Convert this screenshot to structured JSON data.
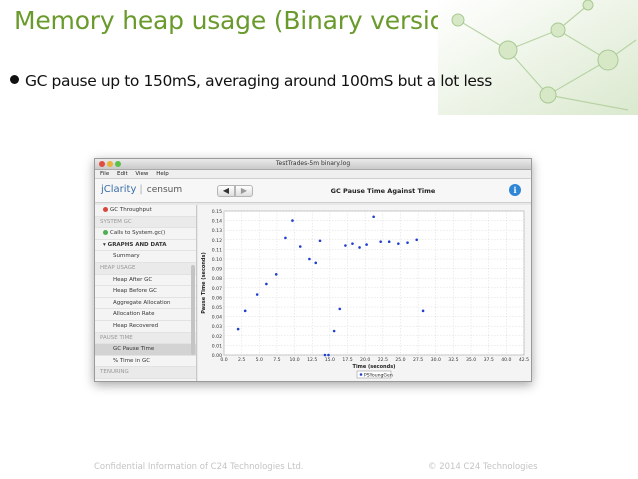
{
  "slide": {
    "title": "Memory heap usage (Binary version)",
    "bullet": "GC pause up to 150mS, averaging around 100mS but a lot less",
    "footer_left": "Confidential Information of C24 Technologies Ltd.",
    "footer_right": "© 2014 C24 Technologies",
    "accent_color": "#6a9a2c"
  },
  "app": {
    "window_title": "TestTrades-5m binary.log",
    "menu": [
      "File",
      "Edit",
      "View",
      "Help"
    ],
    "logo": "jClarity",
    "product": "censum",
    "back_icon": "arrow-left-icon",
    "forward_icon": "arrow-right-icon",
    "info_icon": "info-icon",
    "sidebar": [
      {
        "label": "GC Throughput",
        "kind": "top",
        "status": "red"
      },
      {
        "label": "SYSTEM GC",
        "kind": "section"
      },
      {
        "label": "Calls to System.gc()",
        "kind": "top",
        "status": "green"
      },
      {
        "label": "▾ GRAPHS AND DATA",
        "kind": "group"
      },
      {
        "label": "Summary",
        "kind": "item"
      },
      {
        "label": "HEAP USAGE",
        "kind": "section"
      },
      {
        "label": "Heap After GC",
        "kind": "item"
      },
      {
        "label": "Heap Before GC",
        "kind": "item"
      },
      {
        "label": "Aggregate Allocation",
        "kind": "item"
      },
      {
        "label": "Allocation Rate",
        "kind": "item"
      },
      {
        "label": "Heap Recovered",
        "kind": "item"
      },
      {
        "label": "PAUSE TIME",
        "kind": "section"
      },
      {
        "label": "GC Pause Time",
        "kind": "item",
        "selected": true
      },
      {
        "label": "% Time in GC",
        "kind": "item"
      },
      {
        "label": "TENURING",
        "kind": "section"
      }
    ]
  },
  "chart_data": {
    "type": "scatter",
    "title": "GC Pause Time Against Time",
    "xlabel": "Time (seconds)",
    "ylabel": "Pause Time (seconds)",
    "xlim": [
      0,
      42.5
    ],
    "ylim": [
      0.09,
      0.15
    ],
    "x_ticks": [
      "0.0",
      "2.5",
      "5.0",
      "7.5",
      "10.0",
      "12.5",
      "15.0",
      "17.5",
      "20.0",
      "22.5",
      "25.0",
      "27.5",
      "30.0",
      "32.5",
      "35.0",
      "37.5",
      "40.0",
      "42.5"
    ],
    "y_ticks": [
      "0.15",
      "0.14",
      "0.13",
      "0.12",
      "0.11",
      "0.10",
      "0.09",
      "0.08",
      "0.07",
      "0.06",
      "0.05",
      "0.04",
      "0.03",
      "0.02",
      "0.01",
      "0.00"
    ],
    "grid": true,
    "legend_position": "bottom",
    "series": [
      {
        "name": "PSYoungGen",
        "color": "#1f3fcf",
        "points": [
          [
            2.0,
            0.027
          ],
          [
            3.0,
            0.046
          ],
          [
            4.7,
            0.063
          ],
          [
            6.0,
            0.074
          ],
          [
            7.4,
            0.084
          ],
          [
            8.7,
            0.122
          ],
          [
            9.7,
            0.14
          ],
          [
            10.8,
            0.113
          ],
          [
            12.1,
            0.1
          ],
          [
            13.0,
            0.096
          ],
          [
            13.6,
            0.119
          ],
          [
            14.3,
            0.0
          ],
          [
            14.8,
            0.0
          ],
          [
            15.6,
            0.025
          ],
          [
            16.4,
            0.048
          ],
          [
            17.2,
            0.114
          ],
          [
            18.2,
            0.116
          ],
          [
            19.2,
            0.112
          ],
          [
            20.2,
            0.115
          ],
          [
            21.2,
            0.144
          ],
          [
            22.2,
            0.118
          ],
          [
            23.4,
            0.118
          ],
          [
            24.7,
            0.116
          ],
          [
            26.0,
            0.117
          ],
          [
            27.3,
            0.12
          ],
          [
            28.2,
            0.046
          ]
        ]
      }
    ]
  }
}
